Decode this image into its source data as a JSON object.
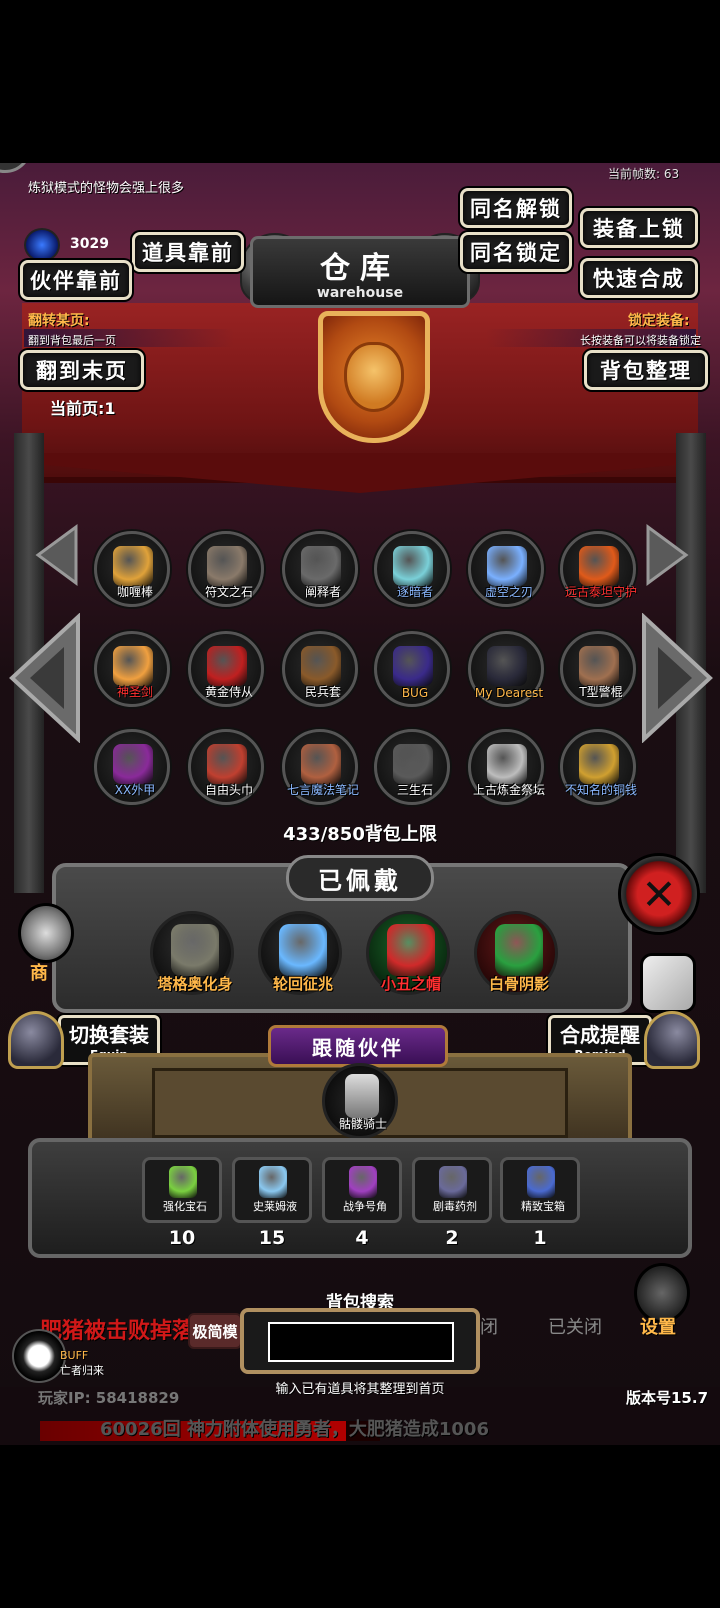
{
  "hud": {
    "hint": "炼狱模式的怪物会强上很多",
    "fps": "当前帧数: 63",
    "gem_count": "3029"
  },
  "header": {
    "title_cn": "仓库",
    "title_en": "warehouse",
    "buttons": {
      "items_front": "道具靠前",
      "partner_front": "伙伴靠前",
      "same_unlock": "同名解锁",
      "same_lock": "同名锁定",
      "equip_lock": "装备上锁",
      "quick_merge": "快速合成",
      "to_last_page": "翻到末页",
      "sort_bag": "背包整理"
    },
    "flip_page_label": "翻转某页:",
    "flip_page_sub": "翻到背包最后一页",
    "lock_equip_label": "锁定装备:",
    "lock_equip_sub": "长按装备可以将装备锁定",
    "current_page": "当前页:1"
  },
  "inventory": {
    "items": [
      {
        "name": "咖喱棒",
        "color": "#e0a23a"
      },
      {
        "name": "符文之石",
        "color": "#8a7a6a"
      },
      {
        "name": "阐释者",
        "color": "#6a6a6a"
      },
      {
        "name": "逐暗者",
        "color": "#7ad0d8"
      },
      {
        "name": "虚空之刃",
        "color": "#7ab0ff"
      },
      {
        "name": "远古泰坦守护",
        "color": "#e05a1a"
      },
      {
        "name": "神圣剑",
        "color": "#f0a040"
      },
      {
        "name": "黄金侍从",
        "color": "#c02020"
      },
      {
        "name": "民兵套",
        "color": "#8a5a2a"
      },
      {
        "name": "BUG",
        "color": "#3a2a8a"
      },
      {
        "name": "My Dearest",
        "color": "#2a2a3a"
      },
      {
        "name": "T型警棍",
        "color": "#a07050"
      },
      {
        "name": "XX外甲",
        "color": "#8a2a9a"
      },
      {
        "name": "自由头巾",
        "color": "#c04030"
      },
      {
        "name": "七言魔法笔记",
        "color": "#b06040"
      },
      {
        "name": "三生石",
        "color": "#5a5a5a"
      },
      {
        "name": "上古炼金祭坛",
        "color": "#bdbdbd"
      },
      {
        "name": "不知名的铜钱",
        "color": "#d0a030"
      }
    ],
    "capacity": "433/850背包上限"
  },
  "equipped": {
    "title": "已佩戴",
    "items": [
      {
        "name": "塔格奥化身",
        "color": "#7a7a6a"
      },
      {
        "name": "轮回征兆",
        "color": "#6ab8ff"
      },
      {
        "name": "小丑之帽",
        "color": "#d02a2a"
      },
      {
        "name": "白骨阴影",
        "color": "#2aa040"
      }
    ],
    "switch_label": "切换套装",
    "switch_en": "Equip",
    "remind_label": "合成提醒",
    "remind_en": "Remind"
  },
  "partner": {
    "title": "跟随伙伴",
    "name": "骷髅骑士"
  },
  "resources": [
    {
      "name": "强化宝石",
      "count": "10",
      "color": "#7ad040"
    },
    {
      "name": "史莱姆液",
      "count": "15",
      "color": "#8ac8f0"
    },
    {
      "name": "战争号角",
      "count": "4",
      "color": "#a040c0"
    },
    {
      "name": "剧毒药剂",
      "count": "2",
      "color": "#6a6a9a"
    },
    {
      "name": "精致宝箱",
      "count": "1",
      "color": "#4a6ad0"
    }
  ],
  "search": {
    "label": "背包搜索",
    "hint": "输入已有道具将其整理到首页",
    "placeholder": ""
  },
  "bottom": {
    "ticker": "肥猪被击败掉落",
    "ticker2": "60026回 神力附体使用勇者，大肥猪造成1006",
    "player_ip": "玩家IP: 58418829",
    "version": "版本号15.7",
    "buff": "BUFF",
    "buff_sub": "亡者归来",
    "settings": "设置",
    "closed": "已关闭",
    "closed_short": "闭",
    "left_btn": "极简模",
    "shop": "商"
  }
}
